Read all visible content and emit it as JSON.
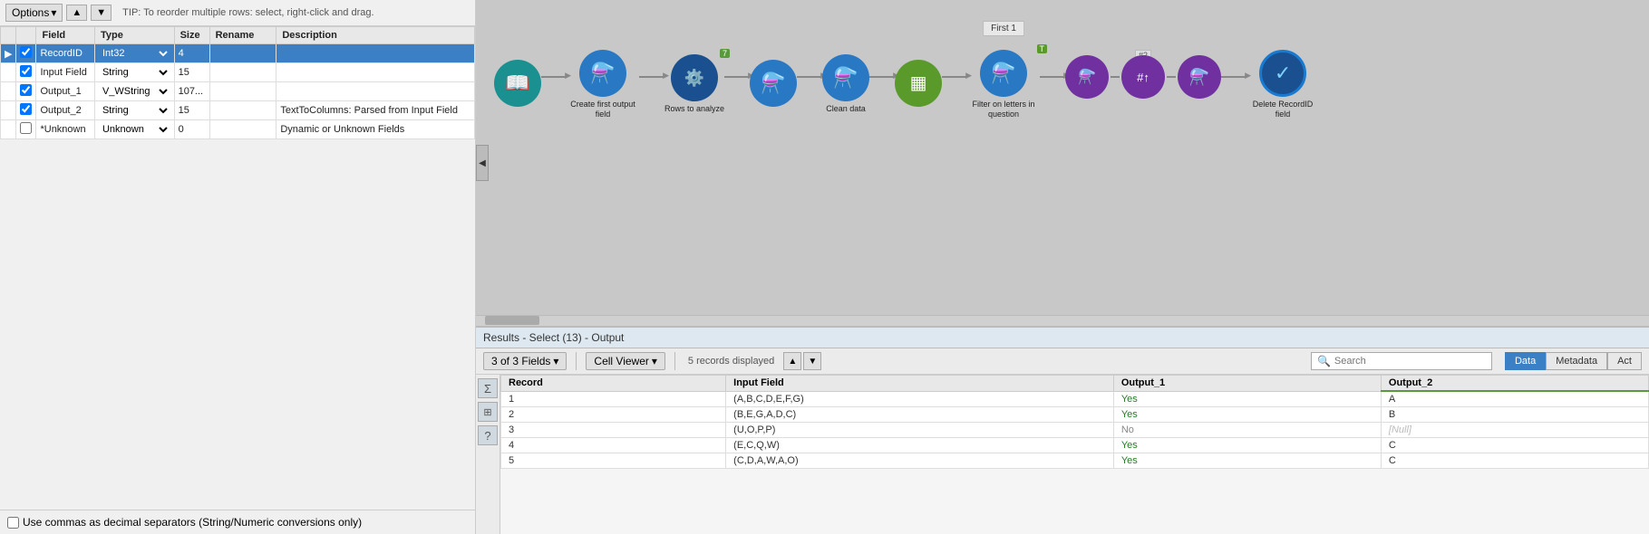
{
  "tip": "TIP: To reorder multiple rows: select, right-click and drag.",
  "toolbar": {
    "options_label": "Options",
    "up_arrow": "▲",
    "down_arrow": "▼"
  },
  "table": {
    "headers": [
      "",
      "",
      "Field",
      "Type",
      "Size",
      "Rename",
      "Description"
    ],
    "rows": [
      {
        "selected": true,
        "checked": true,
        "arrow": true,
        "field": "RecordID",
        "type": "Int32",
        "size": "4",
        "rename": "",
        "description": ""
      },
      {
        "selected": false,
        "checked": true,
        "arrow": false,
        "field": "Input Field",
        "type": "String",
        "size": "15",
        "rename": "",
        "description": ""
      },
      {
        "selected": false,
        "checked": true,
        "arrow": false,
        "field": "Output_1",
        "type": "V_WString",
        "size": "107...",
        "rename": "",
        "description": ""
      },
      {
        "selected": false,
        "checked": true,
        "arrow": false,
        "field": "Output_2",
        "type": "String",
        "size": "15",
        "rename": "",
        "description": "TextToColumns: Parsed from Input Field"
      },
      {
        "selected": false,
        "checked": false,
        "arrow": false,
        "field": "*Unknown",
        "type": "Unknown",
        "size": "0",
        "rename": "",
        "description": "Dynamic or Unknown Fields"
      }
    ]
  },
  "bottom_checkbox": "Use commas as decimal separators (String/Numeric conversions only)",
  "workflow": {
    "nodes": [
      {
        "id": "n1",
        "color": "teal",
        "icon": "📖",
        "label": "",
        "badge": null
      },
      {
        "id": "n2",
        "color": "blue",
        "icon": "⚗",
        "label": "Create first output field",
        "badge": null
      },
      {
        "id": "n3",
        "color": "dark-blue",
        "icon": "⚙",
        "label": "Rows to analyze",
        "badge": "7"
      },
      {
        "id": "n4",
        "color": "blue",
        "icon": "⚗",
        "label": "",
        "badge": null
      },
      {
        "id": "n5",
        "color": "blue",
        "icon": "⚗",
        "label": "Clean data",
        "badge": null
      },
      {
        "id": "n6",
        "color": "green",
        "icon": "▦",
        "label": "",
        "badge": null
      },
      {
        "id": "n7",
        "color": "blue",
        "icon": "⚗",
        "label": "Filter on letters in question",
        "badge": "T"
      },
      {
        "id": "n8",
        "color": "purple",
        "icon": "⚗",
        "label": "",
        "badge": null
      },
      {
        "id": "n9",
        "color": "purple",
        "icon": "#",
        "label": "",
        "badge": "#2"
      },
      {
        "id": "n10",
        "color": "purple",
        "icon": "⚗",
        "label": "",
        "badge": null
      },
      {
        "id": "n11",
        "color": "dark-blue-check",
        "icon": "✓",
        "label": "Delete RecordID field",
        "badge": null
      }
    ],
    "first1_label": "First 1"
  },
  "results": {
    "header": "Results - Select (13) - Output",
    "fields_label": "3 of 3 Fields",
    "cell_viewer_label": "Cell Viewer",
    "records_info": "5 records displayed",
    "search_placeholder": "Search",
    "tabs": [
      {
        "label": "Data",
        "active": true
      },
      {
        "label": "Metadata",
        "active": false
      },
      {
        "label": "Act",
        "active": false
      }
    ],
    "columns": [
      "Record",
      "Input Field",
      "Output_1",
      "Output_2"
    ],
    "rows": [
      {
        "record": "1",
        "input": "(A,B,C,D,E,F,G)",
        "output1": "Yes",
        "output2": "A"
      },
      {
        "record": "2",
        "input": "(B,E,G,A,D,C)",
        "output1": "Yes",
        "output2": "B"
      },
      {
        "record": "3",
        "input": "(U,O,P,P)",
        "output1": "No",
        "output2": "[Null]"
      },
      {
        "record": "4",
        "input": "(E,C,Q,W)",
        "output1": "Yes",
        "output2": "C"
      },
      {
        "record": "5",
        "input": "(C,D,A,W,A,O)",
        "output1": "Yes",
        "output2": "C"
      }
    ]
  }
}
